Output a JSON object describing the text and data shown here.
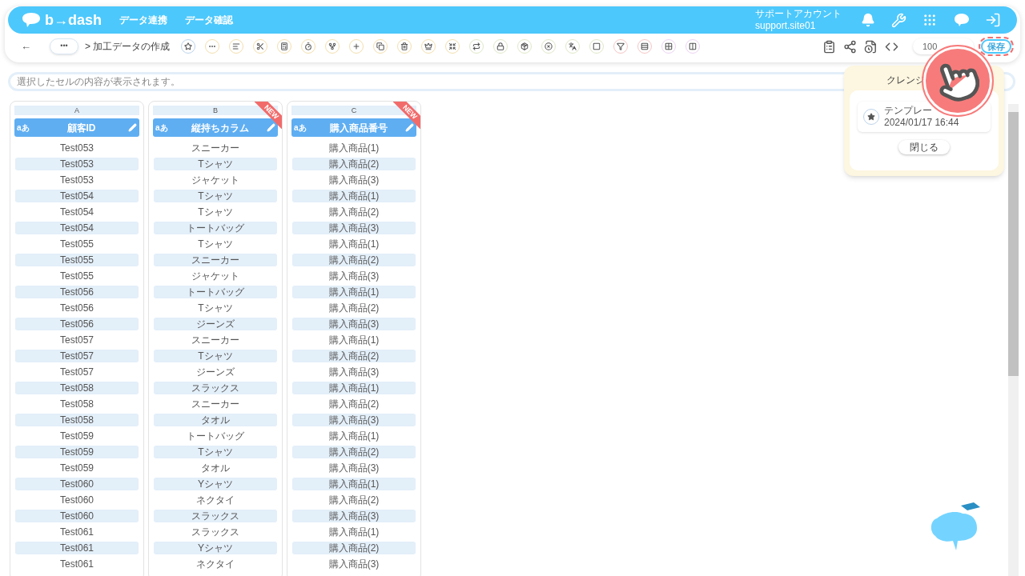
{
  "header": {
    "logo": "b→dash",
    "nav": [
      "データ連携",
      "データ確認"
    ],
    "account_name": "サポートアカウント",
    "account_id": "support.site01"
  },
  "toolbar": {
    "back": "←",
    "more": "•••",
    "breadcrumb": "> 加工データの作成",
    "zoom": "100",
    "save": "保存"
  },
  "formula_bar": {
    "placeholder": "選択したセルの内容が表示されます。"
  },
  "columns": [
    {
      "letter": "A",
      "type_badge": "aあ",
      "name": "顧客ID",
      "new": false,
      "cells": [
        "Test053",
        "Test053",
        "Test053",
        "Test054",
        "Test054",
        "Test054",
        "Test055",
        "Test055",
        "Test055",
        "Test056",
        "Test056",
        "Test056",
        "Test057",
        "Test057",
        "Test057",
        "Test058",
        "Test058",
        "Test058",
        "Test059",
        "Test059",
        "Test059",
        "Test060",
        "Test060",
        "Test060",
        "Test061",
        "Test061",
        "Test061"
      ]
    },
    {
      "letter": "B",
      "type_badge": "aあ",
      "name": "縦持ちカラム",
      "new": true,
      "new_label": "NEW",
      "cells": [
        "スニーカー",
        "Tシャツ",
        "ジャケット",
        "Tシャツ",
        "Tシャツ",
        "トートバッグ",
        "Tシャツ",
        "スニーカー",
        "ジャケット",
        "トートバッグ",
        "Tシャツ",
        "ジーンズ",
        "スニーカー",
        "Tシャツ",
        "ジーンズ",
        "スラックス",
        "スニーカー",
        "タオル",
        "トートバッグ",
        "Tシャツ",
        "タオル",
        "Yシャツ",
        "ネクタイ",
        "スラックス",
        "スラックス",
        "Yシャツ",
        "ネクタイ"
      ]
    },
    {
      "letter": "C",
      "type_badge": "aあ",
      "name": "購入商品番号",
      "new": true,
      "new_label": "NEW",
      "cells": [
        "購入商品(1)",
        "購入商品(2)",
        "購入商品(3)",
        "購入商品(1)",
        "購入商品(2)",
        "購入商品(3)",
        "購入商品(1)",
        "購入商品(2)",
        "購入商品(3)",
        "購入商品(1)",
        "購入商品(2)",
        "購入商品(3)",
        "購入商品(1)",
        "購入商品(2)",
        "購入商品(3)",
        "購入商品(1)",
        "購入商品(2)",
        "購入商品(3)",
        "購入商品(1)",
        "購入商品(2)",
        "購入商品(3)",
        "購入商品(1)",
        "購入商品(2)",
        "購入商品(3)",
        "購入商品(1)",
        "購入商品(2)",
        "購入商品(3)"
      ]
    }
  ],
  "popup": {
    "title": "クレンジ",
    "template_name": "テンプレー",
    "template_date": "2024/01/17 16:44",
    "close": "閉じる"
  }
}
